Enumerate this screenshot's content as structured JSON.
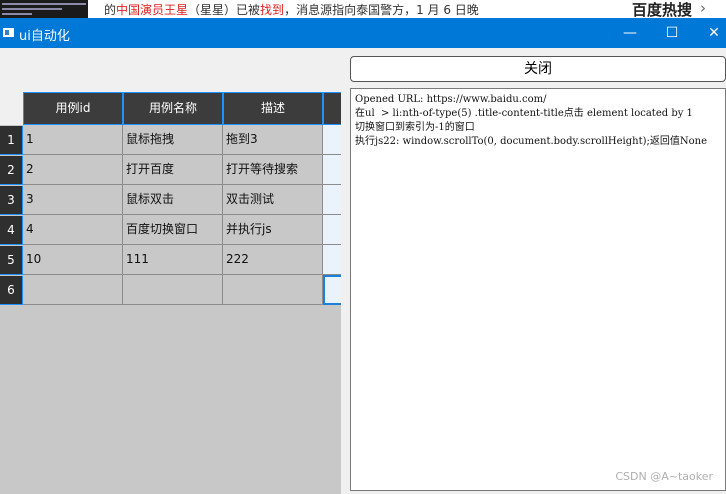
{
  "background_page": {
    "headline_prefix": "的",
    "headline_red1": "中国演员王星",
    "headline_mid": "（星星）已被",
    "headline_red2": "找到",
    "headline_suffix": "，消息源指向泰国警方，1 月 6 日晚",
    "hot_label": "百度热搜",
    "hot_chevron": "›"
  },
  "window": {
    "title": "ui自动化",
    "minimize_glyph": "—",
    "maximize_glyph": "☐",
    "close_glyph": "✕"
  },
  "table": {
    "headers": [
      "用例id",
      "用例名称",
      "描述"
    ],
    "row_numbers": [
      "1",
      "2",
      "3",
      "4",
      "5",
      "6"
    ],
    "rows": [
      [
        "1",
        "鼠标拖拽",
        "拖到3"
      ],
      [
        "2",
        "打开百度",
        "打开等待搜索"
      ],
      [
        "3",
        "鼠标双击",
        "双击测试"
      ],
      [
        "4",
        "百度切换窗口",
        "并执行js"
      ],
      [
        "10",
        "111",
        "222"
      ],
      [
        "",
        "",
        ""
      ]
    ]
  },
  "close_button_label": "关闭",
  "log": {
    "lines": [
      "Opened URL: https://www.baidu.com/",
      "在ul  > li:nth-of-type(5) .title-content-title点击 element located by 1",
      "切换窗口到索引为-1的窗口",
      "执行js22: window.scrollTo(0, document.body.scrollHeight);返回值None"
    ],
    "watermark": "CSDN @A~taoker"
  }
}
